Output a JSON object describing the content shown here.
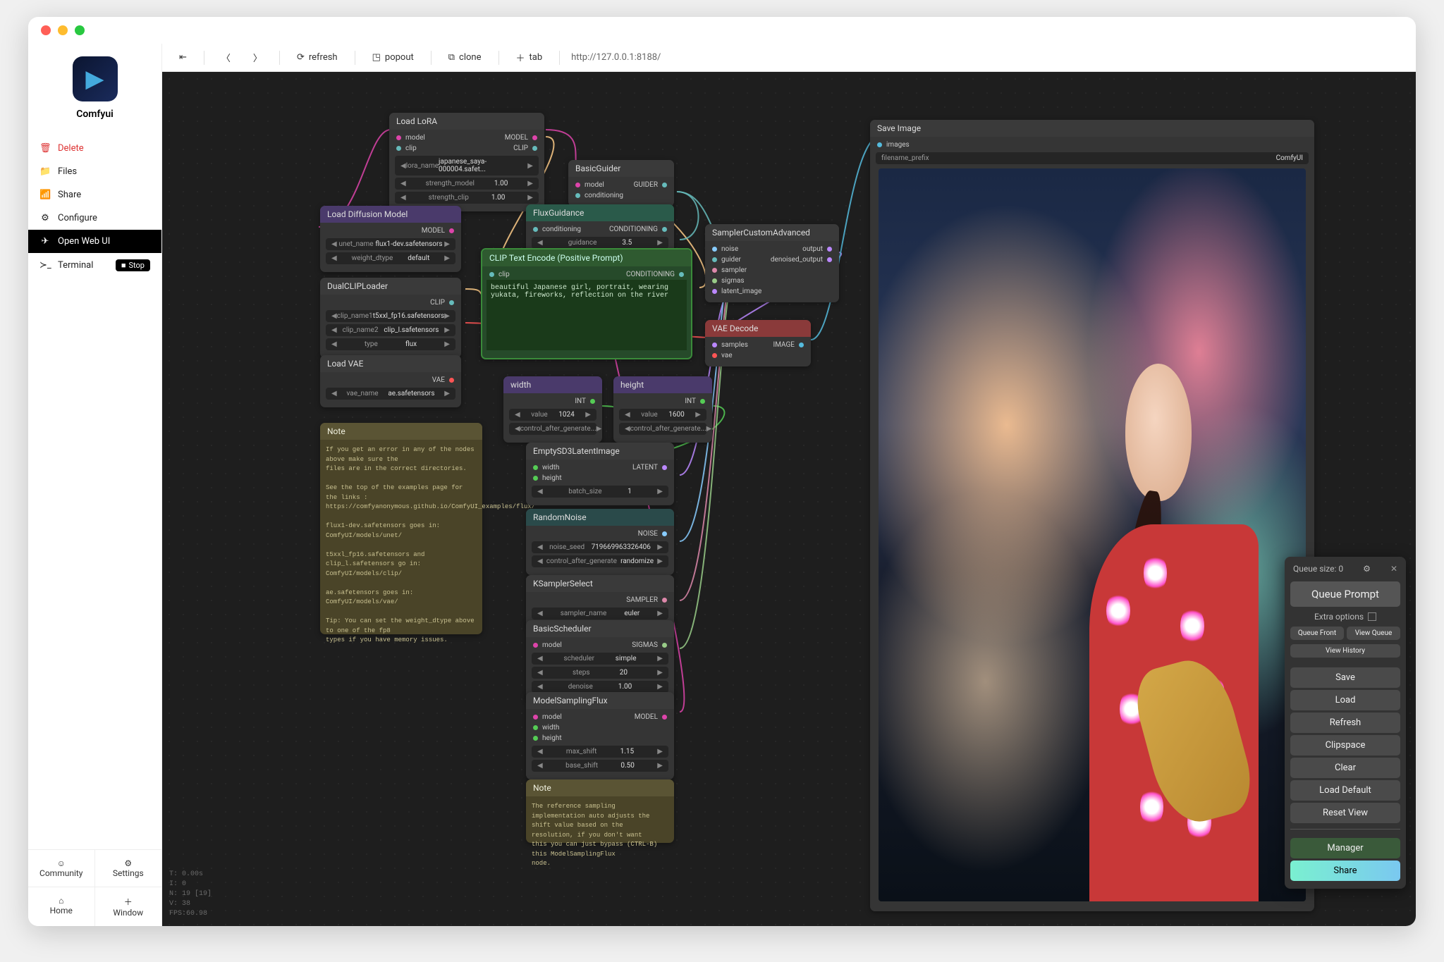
{
  "app": {
    "name": "Comfyui"
  },
  "sidebar": {
    "delete": "Delete",
    "files": "Files",
    "share": "Share",
    "configure": "Configure",
    "open_web": "Open Web UI",
    "terminal": "Terminal",
    "stop": "Stop",
    "community": "Community",
    "settings": "Settings",
    "home": "Home",
    "window": "Window"
  },
  "toolbar": {
    "refresh": "refresh",
    "popout": "popout",
    "clone": "clone",
    "tab": "tab",
    "url": "http://127.0.0.1:8188/"
  },
  "nodes": {
    "load_lora": {
      "title": "Load LoRA",
      "model_in": "model",
      "clip_in": "clip",
      "model_out": "MODEL",
      "clip_out": "CLIP",
      "lora_name_l": "lora_name",
      "lora_name_v": "japanese_saya-000004.safet...",
      "sm_l": "strength_model",
      "sm_v": "1.00",
      "sc_l": "strength_clip",
      "sc_v": "1.00"
    },
    "diff": {
      "title": "Load Diffusion Model",
      "out": "MODEL",
      "unet_l": "unet_name",
      "unet_v": "flux1-dev.safetensors",
      "wd_l": "weight_dtype",
      "wd_v": "default"
    },
    "dual": {
      "title": "DualCLIPLoader",
      "out": "CLIP",
      "c1_l": "clip_name1",
      "c1_v": "t5xxl_fp16.safetensors",
      "c2_l": "clip_name2",
      "c2_v": "clip_l.safetensors",
      "t_l": "type",
      "t_v": "flux"
    },
    "load_vae": {
      "title": "Load VAE",
      "out": "VAE",
      "vn_l": "vae_name",
      "vn_v": "ae.safetensors"
    },
    "note1": {
      "title": "Note",
      "text": "If you get an error in any of the nodes above make sure the\nfiles are in the correct directories.\n\nSee the top of the examples page for the links :\nhttps://comfyanonymous.github.io/ComfyUI_examples/flux/\n\nflux1-dev.safetensors goes in: ComfyUI/models/unet/\n\nt5xxl_fp16.safetensors and clip_l.safetensors go in:\nComfyUI/models/clip/\n\nae.safetensors goes in: ComfyUI/models/vae/\n\nTip: You can set the weight_dtype above to one of the fp8\ntypes if you have memory issues."
    },
    "bg": {
      "title": "BasicGuider",
      "model": "model",
      "cond": "conditioning",
      "out": "GUIDER"
    },
    "fg": {
      "title": "FluxGuidance",
      "cond": "conditioning",
      "out": "CONDITIONING",
      "g_l": "guidance",
      "g_v": "3.5"
    },
    "txt": {
      "title": "CLIP Text Encode (Positive Prompt)",
      "clip": "clip",
      "out": "CONDITIONING",
      "val": "beautiful Japanese girl, portrait, wearing yukata, fireworks, reflection on the river"
    },
    "width": {
      "title": "width",
      "out": "INT",
      "v_l": "value",
      "v_v": "1024",
      "cag": "control_after_generate..."
    },
    "height": {
      "title": "height",
      "out": "INT",
      "v_l": "value",
      "v_v": "1600",
      "cag": "control_after_generate..."
    },
    "emp": {
      "title": "EmptySD3LatentImage",
      "w": "width",
      "h": "height",
      "out": "LATENT",
      "bs_l": "batch_size",
      "bs_v": "1"
    },
    "rn": {
      "title": "RandomNoise",
      "out": "NOISE",
      "seed_l": "noise_seed",
      "seed_v": "719669963326406",
      "cag_l": "control_after_generate",
      "cag_v": "randomize"
    },
    "ks": {
      "title": "KSamplerSelect",
      "out": "SAMPLER",
      "sn_l": "sampler_name",
      "sn_v": "euler"
    },
    "bs": {
      "title": "BasicScheduler",
      "model": "model",
      "out": "SIGMAS",
      "sch_l": "scheduler",
      "sch_v": "simple",
      "st_l": "steps",
      "st_v": "20",
      "dn_l": "denoise",
      "dn_v": "1.00"
    },
    "msf": {
      "title": "ModelSamplingFlux",
      "model": "model",
      "w": "width",
      "h": "height",
      "out": "MODEL",
      "ms_l": "max_shift",
      "ms_v": "1.15",
      "bs_l": "base_shift",
      "bs_v": "0.50"
    },
    "note2": {
      "title": "Note",
      "text": "The reference sampling implementation auto adjusts the\nshift value based on the resolution, if you don't want\nthis you can just bypass (CTRL-B) this ModelSamplingFlux\nnode."
    },
    "adv": {
      "title": "SamplerCustomAdvanced",
      "noise": "noise",
      "guider": "guider",
      "sampler": "sampler",
      "sigmas": "sigmas",
      "latent": "latent_image",
      "out1": "output",
      "out2": "denoised_output"
    },
    "vaed": {
      "title": "VAE Decode",
      "samples": "samples",
      "vae": "vae",
      "out": "IMAGE"
    },
    "save": {
      "title": "Save Image",
      "images": "images",
      "fp_l": "filename_prefix",
      "fp_v": "ComfyUI"
    }
  },
  "panel": {
    "queue_size_l": "Queue size:",
    "queue_size_v": "0",
    "queue_prompt": "Queue Prompt",
    "extra": "Extra options",
    "queue_front": "Queue Front",
    "view_queue": "View Queue",
    "view_history": "View History",
    "save": "Save",
    "load": "Load",
    "refresh": "Refresh",
    "clipspace": "Clipspace",
    "clear": "Clear",
    "load_default": "Load Default",
    "reset_view": "Reset View",
    "manager": "Manager",
    "share": "Share"
  },
  "stats": "T: 0.00s\nI: 0\nN: 19 [19]\nV: 38\nFPS:60.98"
}
